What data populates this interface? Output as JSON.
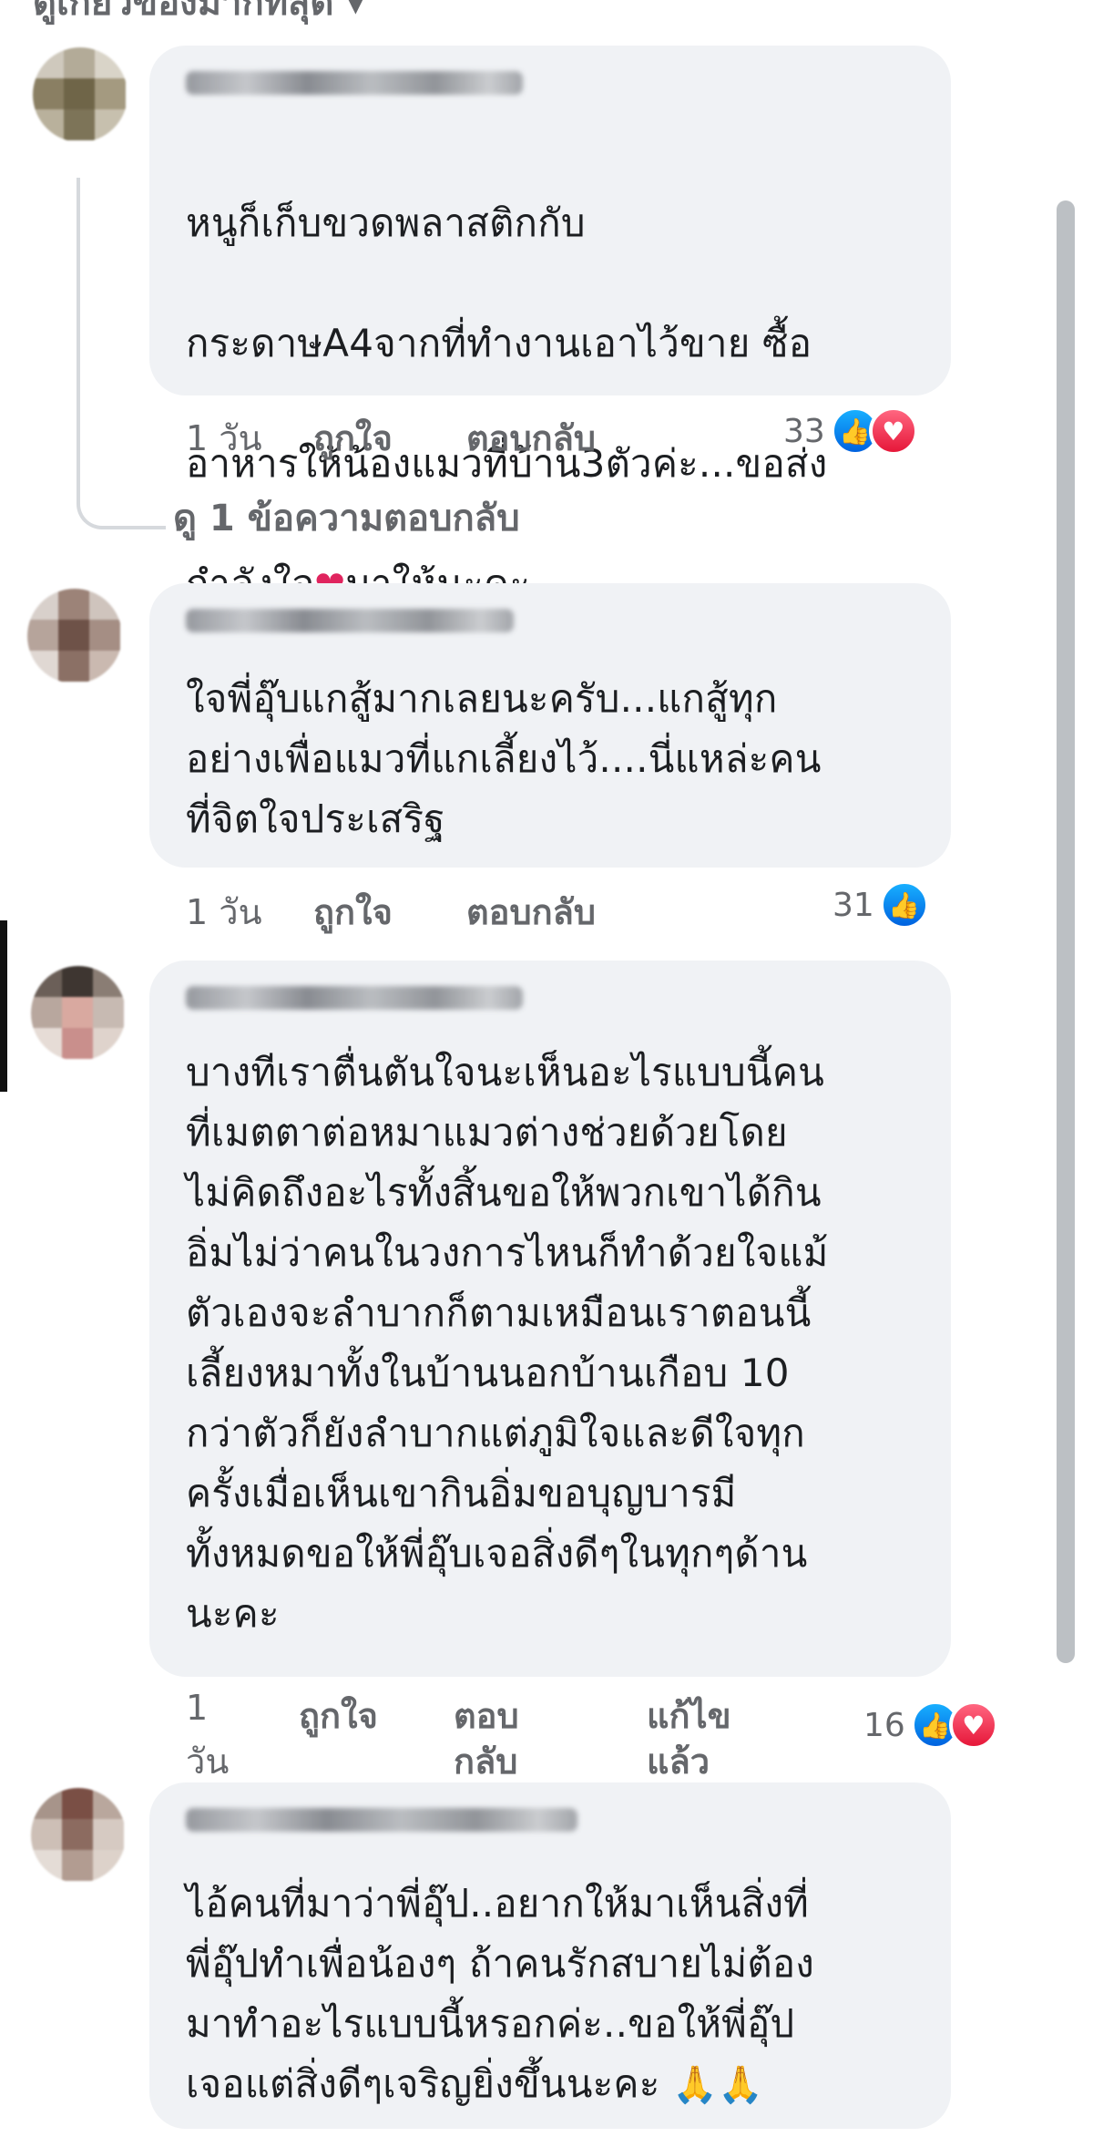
{
  "header": {
    "sort_label_clipped": "ดูเกี่ยวข้องมากที่สุด ▾"
  },
  "comments": [
    {
      "text_lines": [
        "หนูก็เก็บขวดพลาสติกกับ",
        "กระดาษA4จากที่ทำงานเอาไว้ขาย ซื้อ",
        "อาหารให้น้องแมวที่บ้าน3ตัวค่ะ...ขอส่ง",
        "กำลังใจ"
      ],
      "text_tail": "มาให้นะคะ",
      "inline_emoji": "❤",
      "time": "1 วัน",
      "like": "ถูกใจ",
      "reply": "ตอบกลับ",
      "reaction_count": "33"
    },
    {
      "text": "ใจพี่อุ๊บแกสู้มากเลยนะครับ...แกสู้ทุก\nอย่างเพื่อแมวที่แกเลี้ยงไว้....นี่แหล่ะคน\nที่จิตใจประเสริฐ",
      "time": "1 วัน",
      "like": "ถูกใจ",
      "reply": "ตอบกลับ",
      "reaction_count": "31"
    },
    {
      "text": "บางทีเราตื่นตันใจนะเห็นอะไรแบบนี้คน\nที่เมตตาต่อหมาแมวต่างช่วยด้วยโดย\nไม่คิดถึงอะไรทั้งสิ้นขอให้พวกเขาได้กิน\nอิ่มไม่ว่าคนในวงการไหนก็ทำด้วยใจแม้\nตัวเองจะลำบากก็ตามเหมือนเราตอนนี้\nเลี้ยงหมาทั้งในบ้านนอกบ้านเกือบ 10\nกว่าตัวก็ยังลำบากแต่ภูมิใจและดีใจทุก\nครั้งเมื่อเห็นเขากินอิ่มขอบุญบารมี\nทั้งหมดขอให้พี่อุ๊บเจอสิ่งดีๆในทุกๆด้าน\nนะคะ",
      "time_line1": "1",
      "time_line2": "วัน",
      "like": "ถูกใจ",
      "reply_line1": "ตอบ",
      "reply_line2": "กลับ",
      "edited_line1": "แก้ไข",
      "edited_line2": "แล้ว",
      "reaction_count": "16"
    },
    {
      "text_main": "ไอ้คนที่มาว่าพี่อุ๊ป..อยากให้มาเห็นสิ่งที่\nพี่อุ๊ปทำเพื่อน้องๆ ถ้าคนรักสบายไม่ต้อง\nมาทำอะไรแบบนี้หรอกค่ะ..ขอให้พี่อุ๊ป\nเจอแต่สิ่งดีๆเจริญยิ่งขึ้นนะคะ",
      "emoji_tail": "🙏🙏"
    }
  ],
  "view_replies": "ดู 1 ข้อความตอบกลับ",
  "icons": {
    "like": "👍",
    "love": "♥",
    "pray": "🙏"
  },
  "colors": {
    "bubble": "#f0f2f5",
    "meta": "#65676b",
    "like_blue": "#1877f2",
    "love_red": "#e61739"
  }
}
